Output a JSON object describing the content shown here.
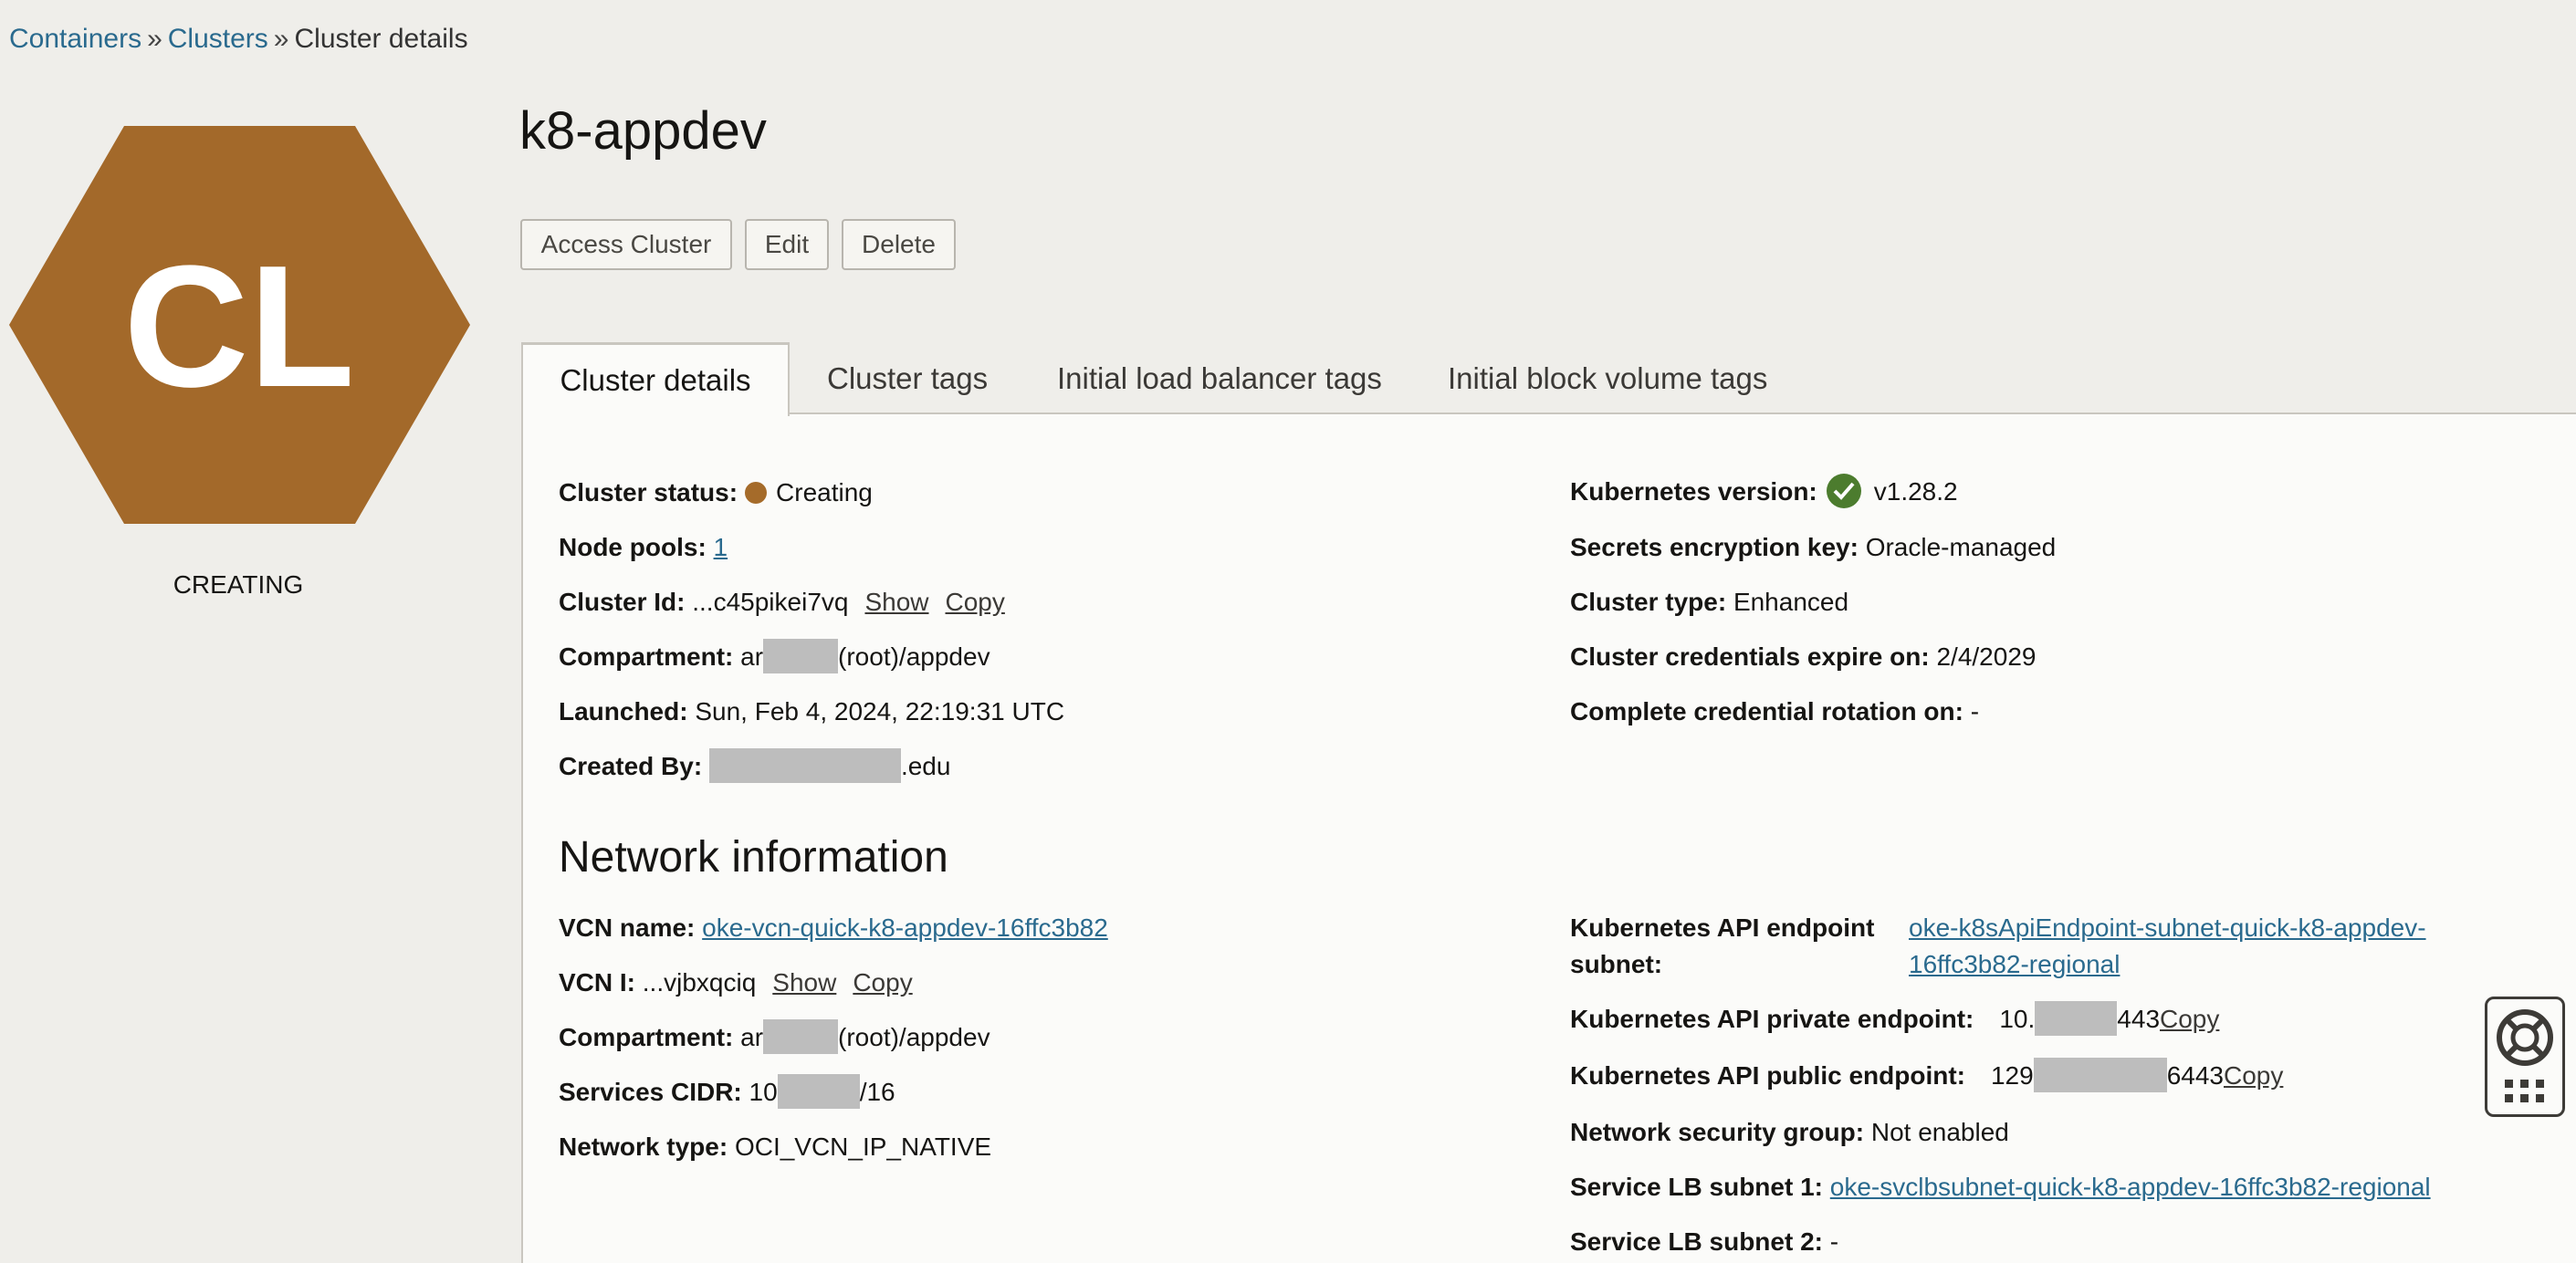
{
  "breadcrumb": {
    "items": [
      "Containers",
      "Clusters"
    ],
    "current": "Cluster details",
    "separator": "»"
  },
  "badge": {
    "initials": "CL",
    "color": "#a3692a",
    "status": "CREATING"
  },
  "page_title": "k8-appdev",
  "actions": {
    "access": "Access Cluster",
    "edit": "Edit",
    "delete": "Delete"
  },
  "tabs": [
    {
      "label": "Cluster details",
      "active": true
    },
    {
      "label": "Cluster tags"
    },
    {
      "label": "Initial load balancer tags"
    },
    {
      "label": "Initial block volume tags"
    }
  ],
  "details_left": {
    "status_label": "Cluster status:",
    "status_value": "Creating",
    "node_pools_label": "Node pools:",
    "node_pools_value": "1",
    "cluster_id_label": "Cluster Id:",
    "cluster_id_value": "...c45pikei7vq",
    "show": "Show",
    "copy": "Copy",
    "compartment_label": "Compartment:",
    "compartment_prefix": "ar",
    "compartment_suffix": "(root)/appdev",
    "launched_label": "Launched:",
    "launched_value": "Sun, Feb 4, 2024, 22:19:31 UTC",
    "created_by_label": "Created By:",
    "created_by_suffix": ".edu"
  },
  "details_right": {
    "k8s_version_label": "Kubernetes version:",
    "k8s_version_value": "v1.28.2",
    "secrets_label": "Secrets encryption key:",
    "secrets_value": "Oracle-managed",
    "cluster_type_label": "Cluster type:",
    "cluster_type_value": "Enhanced",
    "credentials_label": "Cluster credentials expire on:",
    "credentials_value": "2/4/2029",
    "rotation_label": "Complete credential rotation on:",
    "rotation_value": "-"
  },
  "network": {
    "heading": "Network information",
    "vcn_name_label": "VCN name:",
    "vcn_name_value": "oke-vcn-quick-k8-appdev-16ffc3b82",
    "vcn_id_label": "VCN I:",
    "vcn_id_value": "...vjbxqciq",
    "show": "Show",
    "copy": "Copy",
    "compartment_label": "Compartment:",
    "compartment_prefix": "ar",
    "compartment_suffix": "(root)/appdev",
    "cidr_label": "Services CIDR:",
    "cidr_prefix": "10",
    "cidr_suffix": "/16",
    "network_type_label": "Network type:",
    "network_type_value": "OCI_VCN_IP_NATIVE",
    "api_subnet_label_1": "Kubernetes API endpoint",
    "api_subnet_label_2": "subnet:",
    "api_subnet_value_1": "oke-k8sApiEndpoint-subnet-quick-k8-appdev-",
    "api_subnet_value_2": "16ffc3b82-regional",
    "private_endpoint_label": "Kubernetes API private endpoint:",
    "private_endpoint_prefix": "10.",
    "private_endpoint_suffix": "443",
    "public_endpoint_label": "Kubernetes API public endpoint:",
    "public_endpoint_prefix": "129",
    "public_endpoint_suffix": "6443",
    "nsg_label": "Network security group:",
    "nsg_value": "Not enabled",
    "lb1_label": "Service LB subnet 1:",
    "lb1_value": "oke-svclbsubnet-quick-k8-appdev-16ffc3b82-regional",
    "lb2_label": "Service LB subnet 2:",
    "lb2_value": "-"
  },
  "icons": {
    "status_dot": "status-dot-icon",
    "check": "check-circle-icon",
    "help": "lifebuoy-icon",
    "apps": "grid-icon"
  }
}
